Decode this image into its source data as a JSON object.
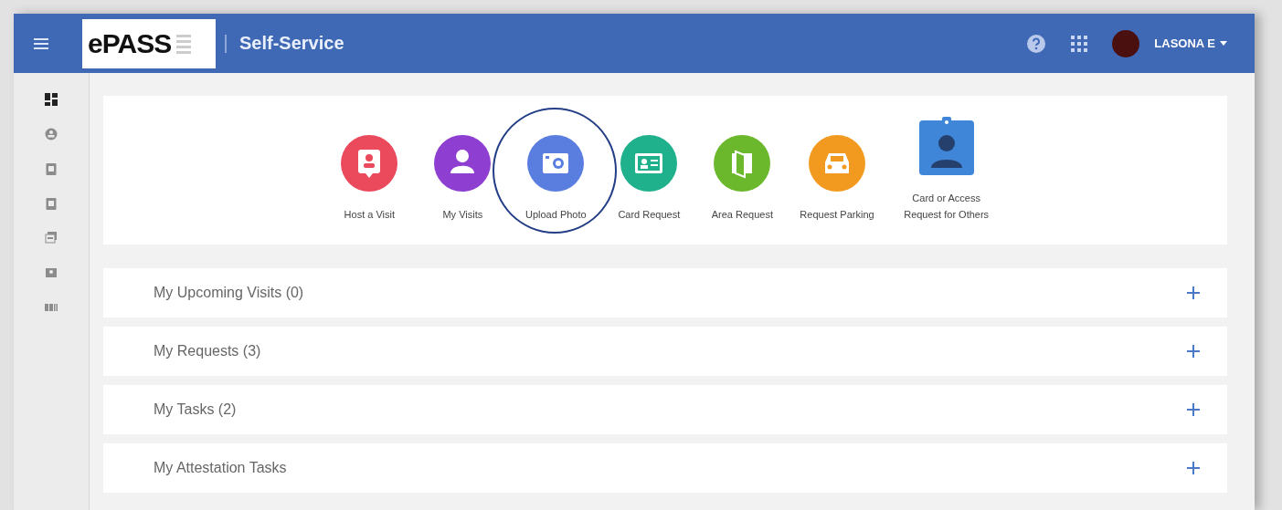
{
  "header": {
    "logo": "ePASS",
    "title": "Self-Service",
    "user": "LASONA E"
  },
  "sidebar": {
    "items": [
      {
        "kind": "dashboard",
        "selected": true
      },
      {
        "kind": "person",
        "selected": false
      },
      {
        "kind": "clipboard",
        "selected": false
      },
      {
        "kind": "clipboard",
        "selected": false
      },
      {
        "kind": "stack",
        "selected": false
      },
      {
        "kind": "card",
        "selected": false
      },
      {
        "kind": "grid",
        "selected": false
      }
    ]
  },
  "tiles": [
    {
      "label": "Host a Visit",
      "kind": "host",
      "color": "#ea4a5c",
      "highlighted": false
    },
    {
      "label": "My Visits",
      "kind": "person",
      "color": "#8e3ed0",
      "highlighted": false
    },
    {
      "label": "Upload Photo",
      "kind": "camera",
      "color": "#5a7ee0",
      "highlighted": true
    },
    {
      "label": "Card Request",
      "kind": "idcard",
      "color": "#1fb08c",
      "highlighted": false
    },
    {
      "label": "Area Request",
      "kind": "door",
      "color": "#6cb82c",
      "highlighted": false
    },
    {
      "label": "Request Parking",
      "kind": "car",
      "color": "#f29a1f",
      "highlighted": false
    },
    {
      "label": "Card or Access Request for Others",
      "kind": "badge",
      "color": "#3f86d8",
      "highlighted": false
    }
  ],
  "sections": [
    {
      "title": "My Upcoming Visits (0)",
      "expanded": false
    },
    {
      "title": "My Requests (3)",
      "expanded": false
    },
    {
      "title": "My Tasks (2)",
      "expanded": false
    },
    {
      "title": "My Attestation Tasks",
      "expanded": false
    }
  ]
}
